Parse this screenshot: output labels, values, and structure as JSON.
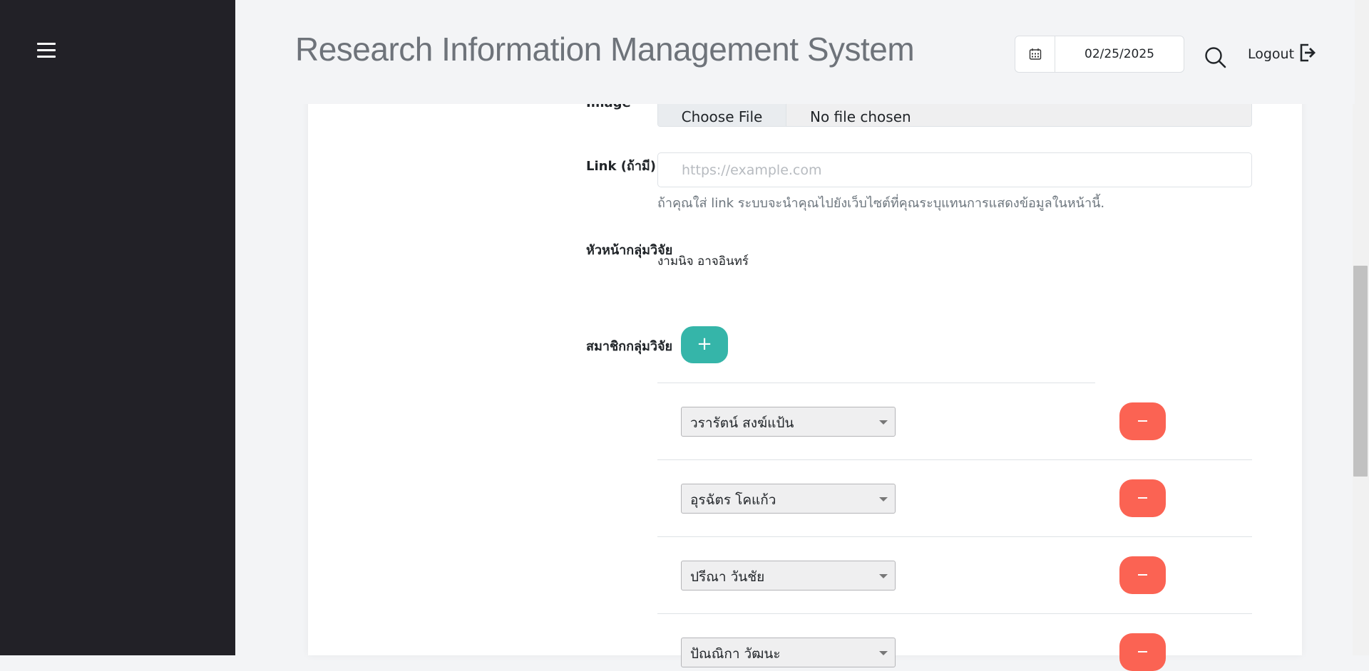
{
  "header": {
    "title": "Research Information Management System",
    "date": "02/25/2025",
    "logout_label": "Logout"
  },
  "form": {
    "image_label": "Image",
    "file_button_label": "Choose File",
    "file_status": "No file chosen",
    "link_label": "Link (ถ้ามี)",
    "link_placeholder": "https://example.com",
    "link_value": "",
    "link_help": "ถ้าคุณใส่ link ระบบจะนำคุณไปยังเว็บไซต์ที่คุณระบุแทนการแสดงข้อมูลในหน้านี้.",
    "leader_label": "หัวหน้ากลุ่มวิจัย",
    "leader_name": "งามนิจ อาจอินทร์",
    "members_label": "สมาชิกกลุ่มวิจัย",
    "add_member_label": "+",
    "members": [
      "วรารัตน์ สงฆ์แป้น",
      "อุรฉัตร โคแก้ว",
      "ปรีณา วันชัย",
      "ปัณณิกา วัฒนะ"
    ]
  },
  "icons": {
    "menu": "hamburger-menu-icon",
    "calendar": "calendar-icon",
    "search": "search-icon",
    "logout": "logout-icon"
  },
  "colors": {
    "sidebar": "#222127",
    "add_button": "#35b5a9",
    "remove_button": "#fb6353",
    "title": "#6e737a"
  }
}
